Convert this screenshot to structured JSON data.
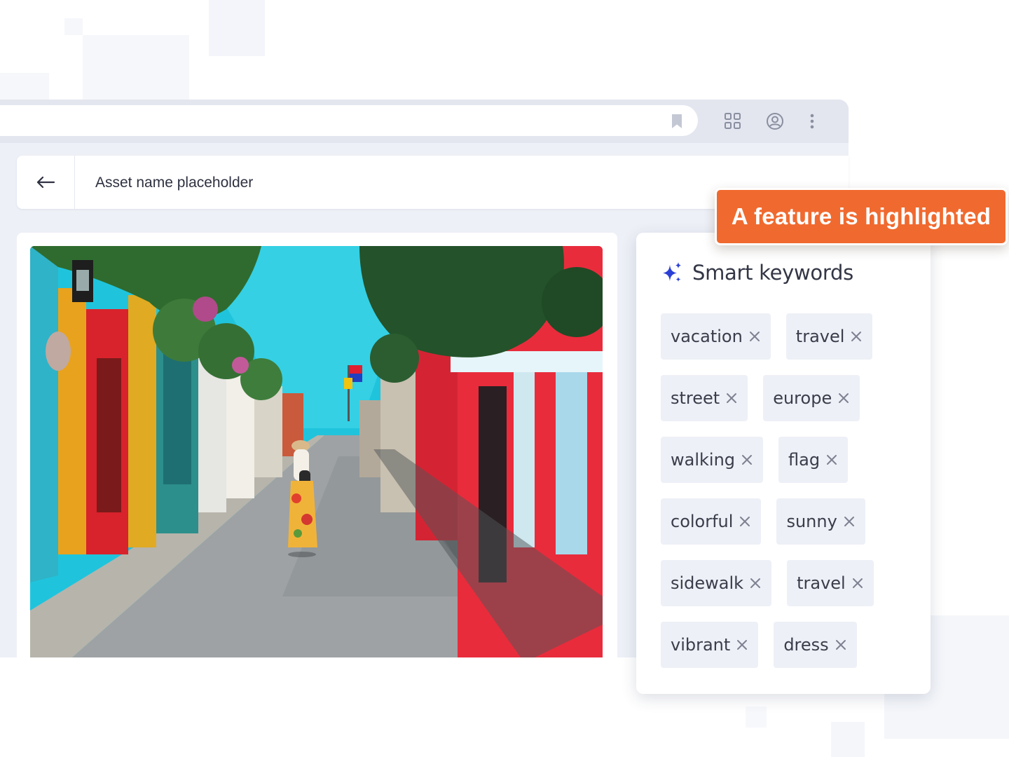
{
  "colors": {
    "accent": "#f06a2f",
    "chip_bg": "#eef0f7",
    "sparkle": "#2b3fd6"
  },
  "browser": {
    "icons": [
      "bookmark-icon",
      "apps-grid-icon",
      "account-circle-icon",
      "more-vertical-icon"
    ]
  },
  "asset": {
    "title": "Asset name placeholder"
  },
  "keywords": {
    "title": "Smart keywords",
    "items": [
      "vacation",
      "travel",
      "street",
      "europe",
      "walking",
      "flag",
      "colorful",
      "sunny",
      "sidewalk",
      "travel",
      "vibrant",
      "dress"
    ]
  },
  "callout": {
    "text": "A feature is highlighted"
  }
}
